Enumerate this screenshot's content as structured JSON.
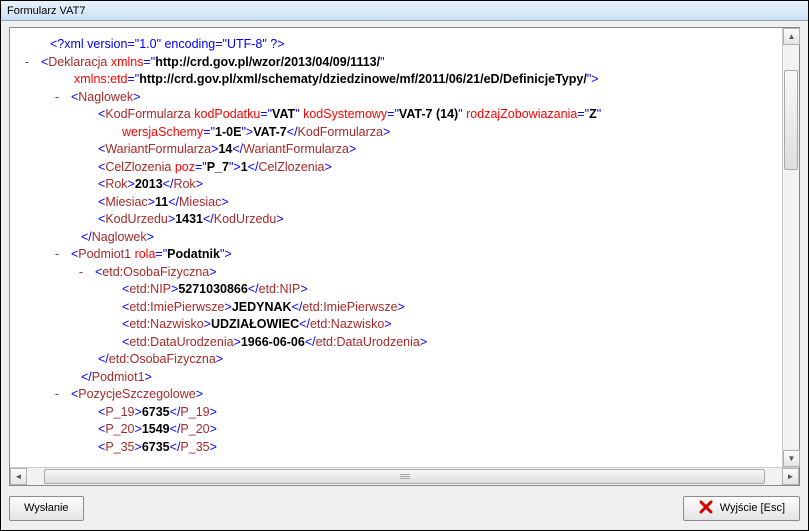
{
  "window": {
    "title": "Formularz VAT7"
  },
  "buttons": {
    "send": "Wysłanie",
    "exit": "Wyjście  [Esc]"
  },
  "xml": {
    "declaration": "<?xml version=\"1.0\" encoding=\"UTF-8\" ?>",
    "root": {
      "name": "Deklaracja",
      "attrs": {
        "xmlns": "http://crd.gov.pl/wzor/2013/04/09/1113/",
        "xmlns:etd": "http://crd.gov.pl/xml/schematy/dziedzinowe/mf/2011/06/21/eD/DefinicjeTypy/"
      }
    },
    "naglowek": {
      "name": "Naglowek",
      "kodFormularza": {
        "name": "KodFormularza",
        "attrs": {
          "kodPodatku": "VAT",
          "kodSystemowy": "VAT-7 (14)",
          "rodzajZobowiazania": "Z",
          "wersjaSchemy": "1-0E"
        },
        "text": "VAT-7"
      },
      "wariant": {
        "name": "WariantFormularza",
        "text": "14"
      },
      "cel": {
        "name": "CelZlozenia",
        "attrs": {
          "poz": "P_7"
        },
        "text": "1"
      },
      "rok": {
        "name": "Rok",
        "text": "2013"
      },
      "miesiac": {
        "name": "Miesiac",
        "text": "11"
      },
      "kodUrzedu": {
        "name": "KodUrzedu",
        "text": "1431"
      }
    },
    "podmiot": {
      "name": "Podmiot1",
      "attrs": {
        "rola": "Podatnik"
      },
      "osoba": {
        "name": "etd:OsobaFizyczna",
        "nip": {
          "name": "etd:NIP",
          "text": "5271030866"
        },
        "imie": {
          "name": "etd:ImiePierwsze",
          "text": "JEDYNAK"
        },
        "nazwisko": {
          "name": "etd:Nazwisko",
          "text": "UDZIAŁOWIEC"
        },
        "data": {
          "name": "etd:DataUrodzenia",
          "text": "1966-06-06"
        }
      }
    },
    "pozycje": {
      "name": "PozycjeSzczegolowe",
      "p19": {
        "name": "P_19",
        "text": "6735"
      },
      "p20": {
        "name": "P_20",
        "text": "1549"
      },
      "p35": {
        "name": "P_35",
        "text": "6735"
      }
    }
  }
}
